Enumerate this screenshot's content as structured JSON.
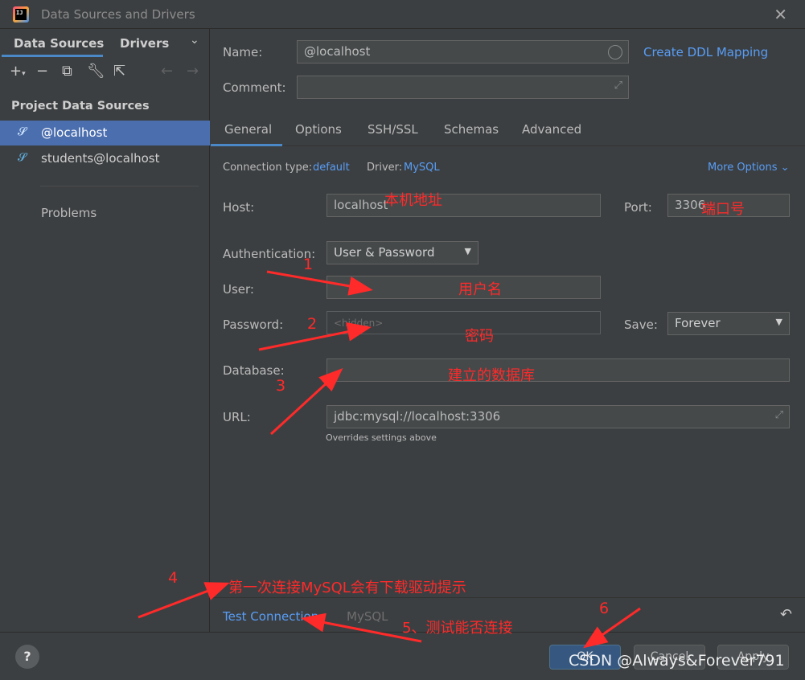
{
  "window": {
    "title": "Data Sources and Drivers",
    "app_icon_text": "IJ"
  },
  "left_panel": {
    "tabs": [
      "Data Sources",
      "Drivers"
    ],
    "section_label": "Project Data Sources",
    "items": [
      "@localhost",
      "students@localhost"
    ],
    "problems_label": "Problems"
  },
  "form": {
    "name_label": "Name:",
    "name_value": "@localhost",
    "ddl_link": "Create DDL Mapping",
    "comment_label": "Comment:",
    "comment_value": "",
    "tabs": [
      "General",
      "Options",
      "SSH/SSL",
      "Schemas",
      "Advanced"
    ],
    "connection_type_label": "Connection type:",
    "connection_type_value": "default",
    "driver_label": "Driver:",
    "driver_value": "MySQL",
    "more_options": "More Options",
    "host_label": "Host:",
    "host_value": "localhost",
    "port_label": "Port:",
    "port_value": "3306",
    "auth_label": "Authentication:",
    "auth_value": "User & Password",
    "user_label": "User:",
    "user_value": "",
    "password_label": "Password:",
    "password_placeholder": "<hidden>",
    "save_label": "Save:",
    "save_value": "Forever",
    "database_label": "Database:",
    "database_value": "",
    "url_label": "URL:",
    "url_value": "jdbc:mysql://localhost:3306",
    "url_hint": "Overrides settings above"
  },
  "bottom": {
    "test_connection": "Test Connection",
    "driver_name": "MySQL"
  },
  "footer": {
    "help": "?",
    "ok": "OK",
    "cancel": "Cancel",
    "apply": "Apply"
  },
  "annotations": {
    "host_note": "本机地址",
    "port_note": "端口号",
    "user_note": "用户名",
    "password_note": "密码",
    "database_note": "建立的数据库",
    "n1": "1",
    "n2": "2",
    "n3": "3",
    "n4": "4",
    "n4_text": "第一次连接MySQL会有下载驱动提示",
    "n5_text": "5、测试能否连接",
    "n6": "6"
  },
  "watermark": "CSDN @Always&Forever791",
  "colors": {
    "accent": "#4a88c7",
    "link": "#589df6",
    "selection": "#4b6eaf",
    "annotation": "#ff2a2a"
  }
}
